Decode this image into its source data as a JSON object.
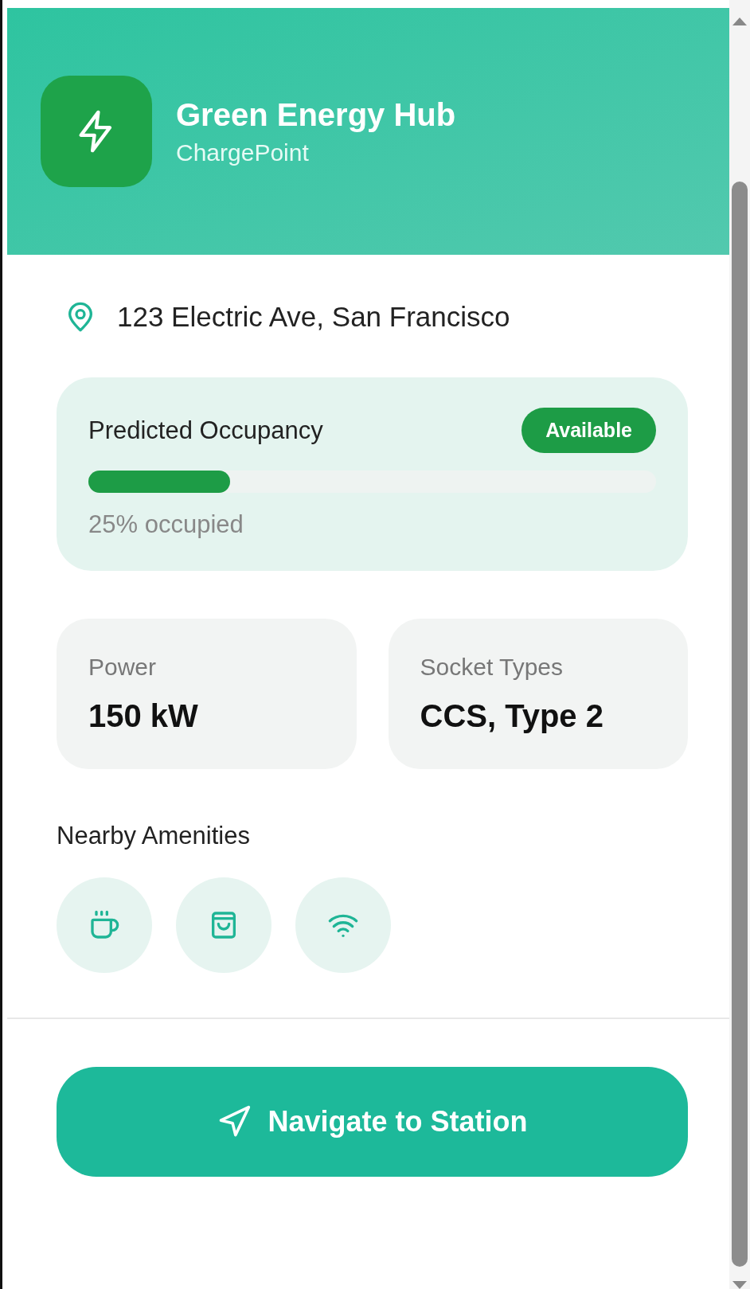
{
  "header": {
    "title": "Green Energy Hub",
    "subtitle": "ChargePoint"
  },
  "address": "123 Electric Ave, San Francisco",
  "occupancy": {
    "title": "Predicted Occupancy",
    "badge": "Available",
    "level": 0.25,
    "reading": "25% occupied"
  },
  "specs": [
    {
      "label": "Power",
      "value": "150 kW"
    },
    {
      "label": "Socket Types",
      "value": "CCS, Type 2"
    }
  ],
  "amenities": {
    "title": "Nearby Amenities",
    "items": [
      {
        "kind": "cafe"
      },
      {
        "kind": "shopping"
      },
      {
        "kind": "wifi"
      }
    ]
  },
  "action": {
    "label": "Navigate to Station"
  }
}
